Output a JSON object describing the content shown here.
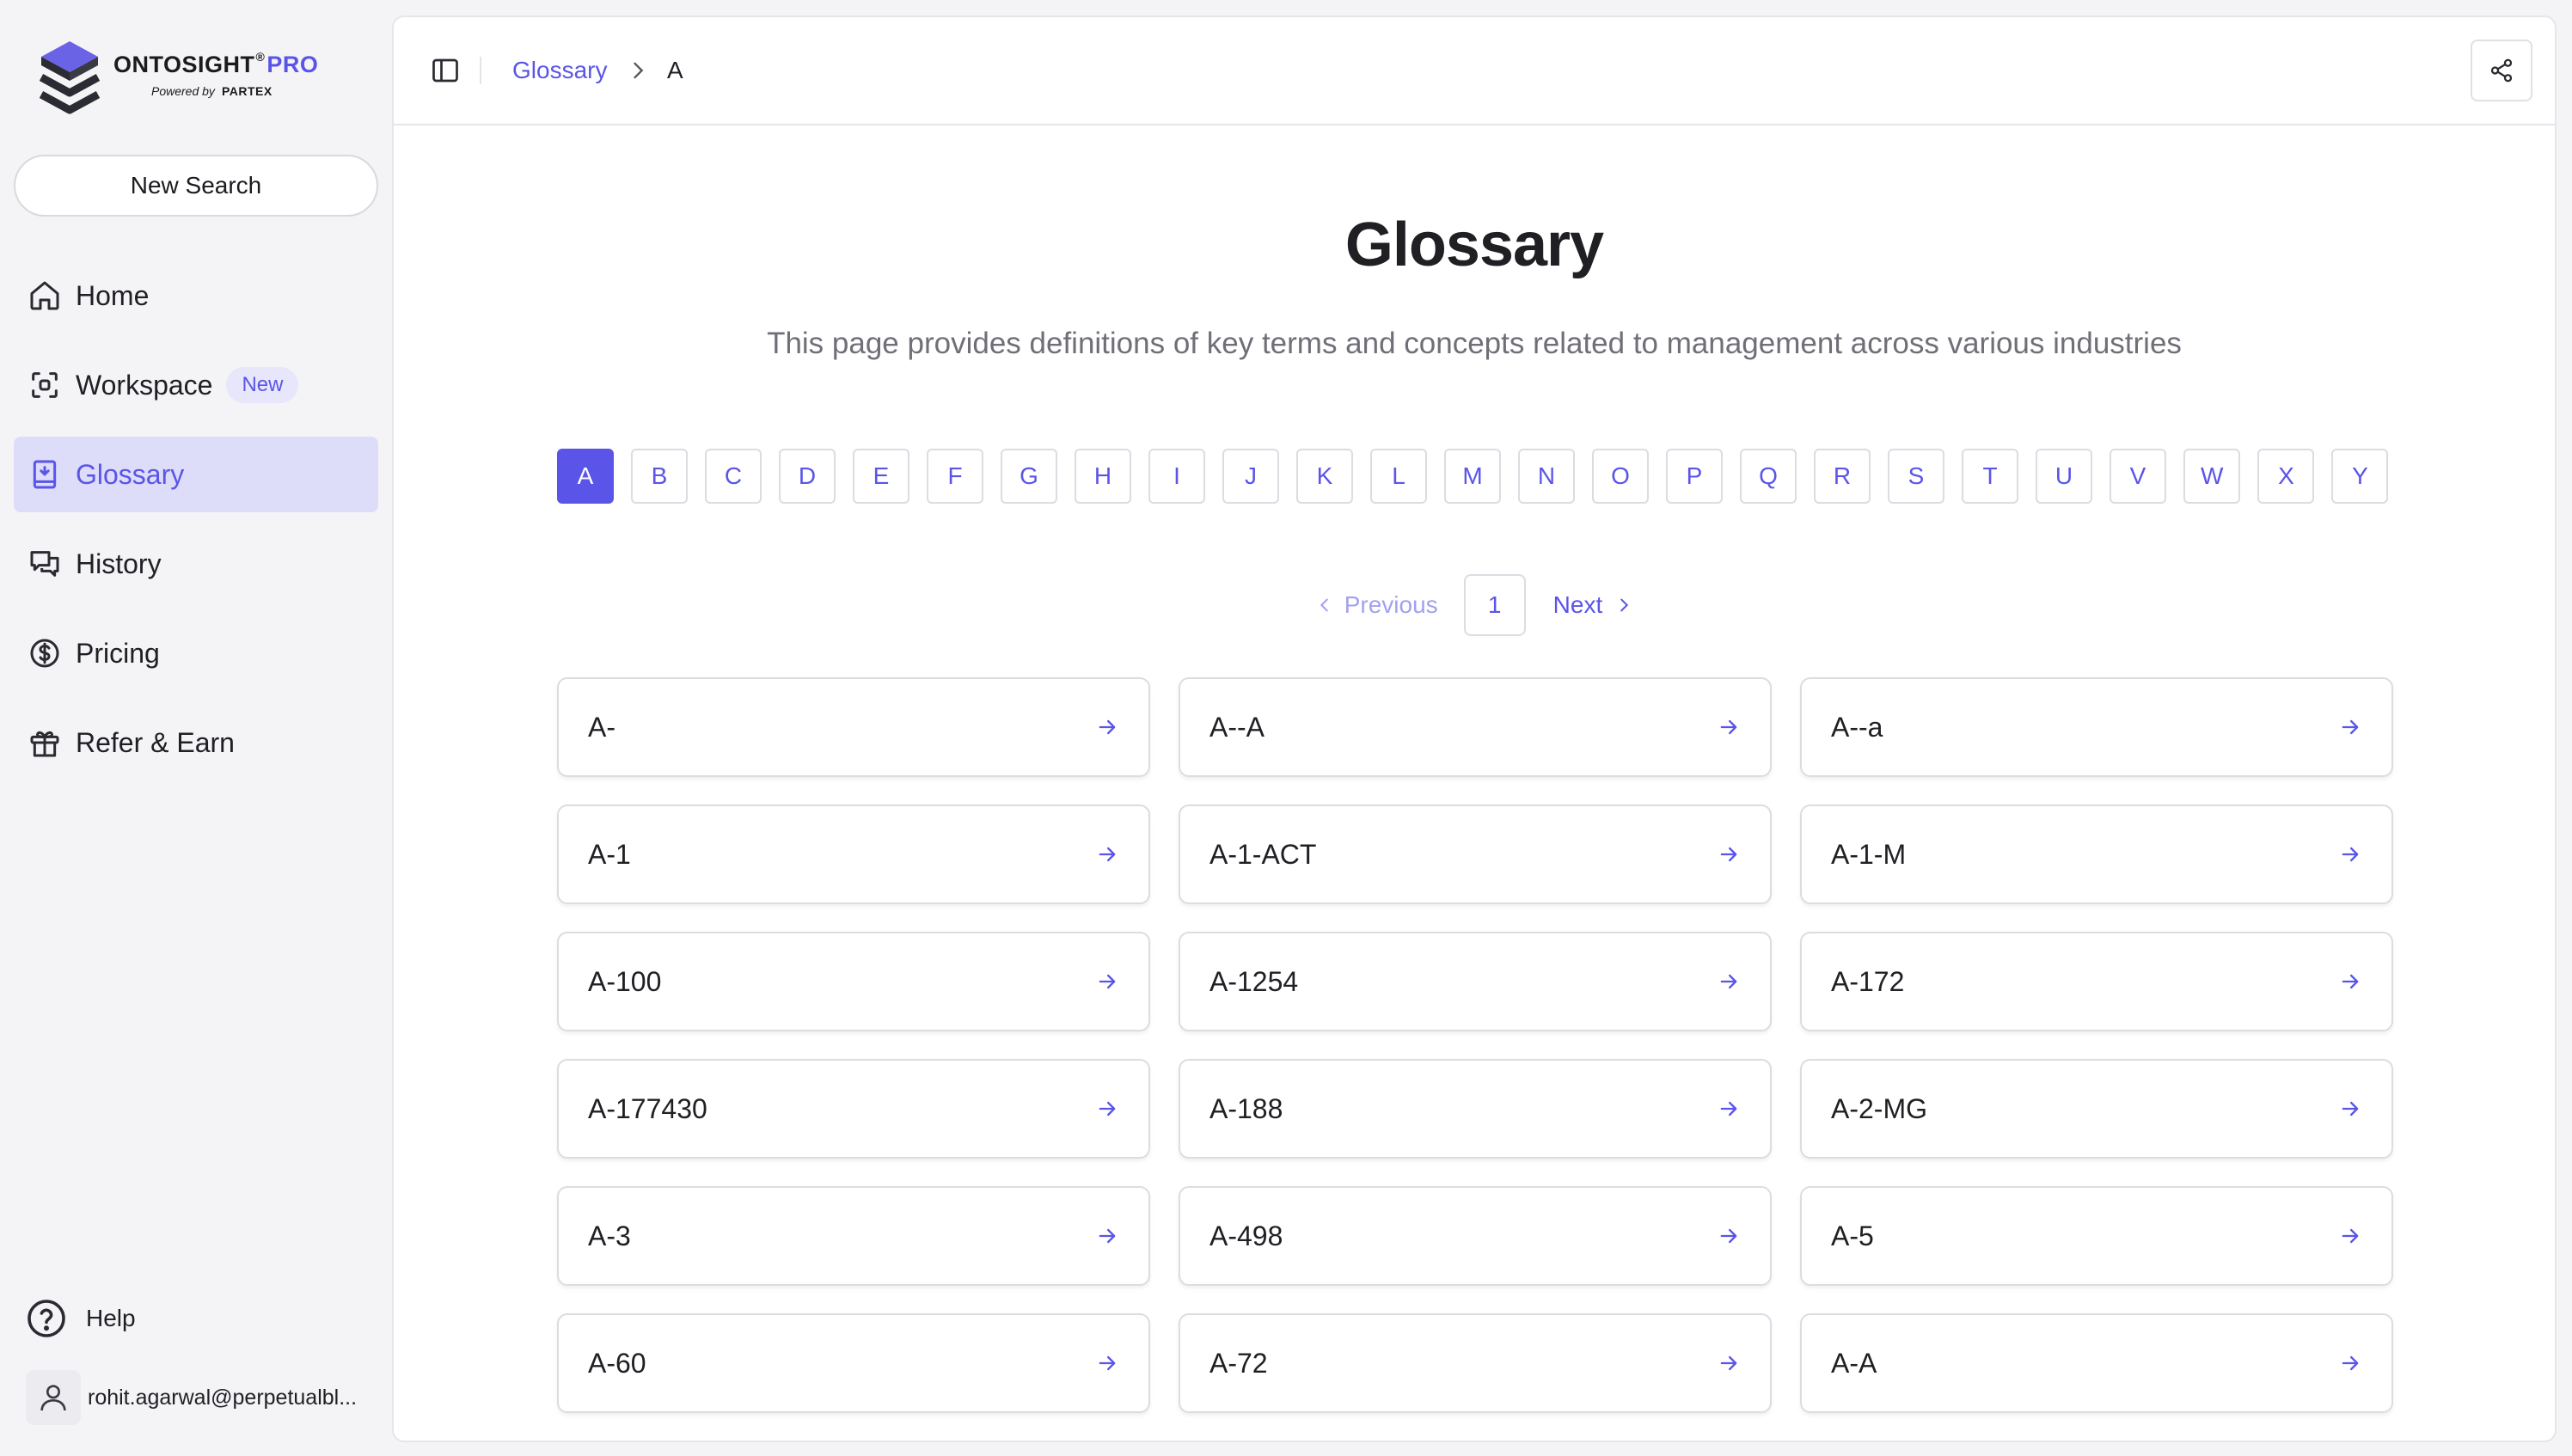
{
  "brand": {
    "name": "ONTOSIGHT",
    "registered": "®",
    "tier": "PRO",
    "powered_by": "Powered by",
    "partner": "PARTEX"
  },
  "sidebar": {
    "new_search": "New Search",
    "items": [
      {
        "label": "Home",
        "icon": "home-icon"
      },
      {
        "label": "Workspace",
        "icon": "scan-icon",
        "badge": "New"
      },
      {
        "label": "Glossary",
        "icon": "book-icon",
        "active": true
      },
      {
        "label": "History",
        "icon": "chat-history-icon"
      },
      {
        "label": "Pricing",
        "icon": "dollar-circle-icon"
      },
      {
        "label": "Refer & Earn",
        "icon": "gift-icon"
      }
    ],
    "help": "Help",
    "user_email": "rohit.agarwal@perpetualbl..."
  },
  "header": {
    "breadcrumb_link": "Glossary",
    "breadcrumb_current": "A",
    "share_icon": "share-icon"
  },
  "page": {
    "title": "Glossary",
    "description": "This page provides definitions of key terms and concepts related to management across various industries"
  },
  "letters": [
    "A",
    "B",
    "C",
    "D",
    "E",
    "F",
    "G",
    "H",
    "I",
    "J",
    "K",
    "L",
    "M",
    "N",
    "O",
    "P",
    "Q",
    "R",
    "S",
    "T",
    "U",
    "V",
    "W",
    "X",
    "Y"
  ],
  "active_letter": "A",
  "pagination": {
    "previous": "Previous",
    "current": "1",
    "next": "Next"
  },
  "terms": [
    "A-",
    "A--A",
    "A--a",
    "A-1",
    "A-1-ACT",
    "A-1-M",
    "A-100",
    "A-1254",
    "A-172",
    "A-177430",
    "A-188",
    "A-2-MG",
    "A-3",
    "A-498",
    "A-5",
    "A-60",
    "A-72",
    "A-A"
  ],
  "colors": {
    "accent": "#5a55e8",
    "accent_light": "#dddcf9",
    "muted_text": "#6f6f78"
  }
}
